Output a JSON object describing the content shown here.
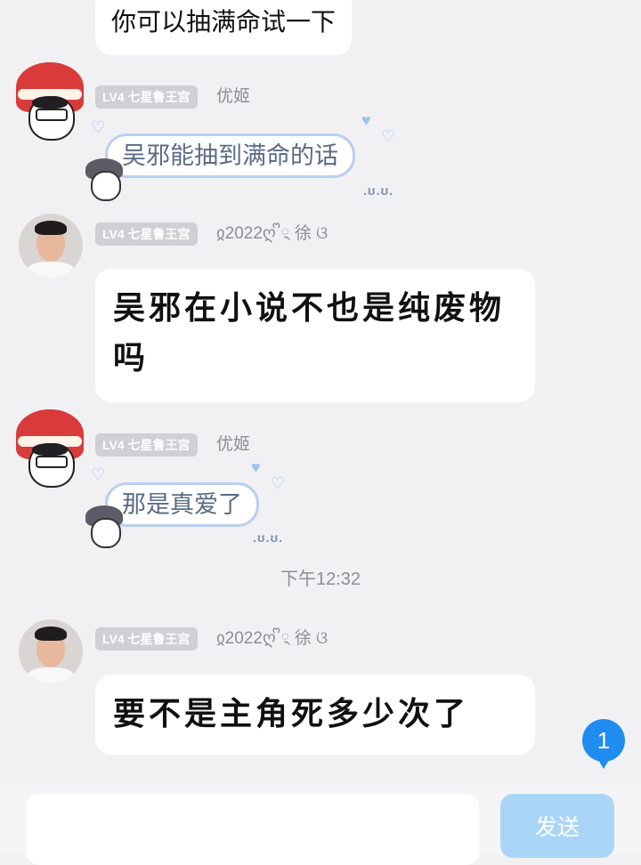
{
  "messages": [
    {
      "text": "你可以抽满命试一下"
    },
    {
      "level": "LV4 七星鲁王宫",
      "sender": "优姬",
      "text": "吴邪能抽到满命的话"
    },
    {
      "level": "LV4 七星鲁王宫",
      "sender": "ჲ2022ღ ᩚ྄  徐 ଓ",
      "text": "吴邪在小说不也是纯废物吗"
    },
    {
      "level": "LV4 七星鲁王宫",
      "sender": "优姬",
      "text": "那是真爱了"
    },
    {
      "level": "LV4 七星鲁王宫",
      "sender": "ჲ2022ღ ᩚ྄  徐 ଓ",
      "text": "要不是主角死多少次了"
    }
  ],
  "timestamp": "下午12:32",
  "unread_count": "1",
  "input": {
    "placeholder": "",
    "send_label": "发送"
  },
  "colors": {
    "background": "#f1f1f4",
    "bubble": "#ffffff",
    "level_badge": "#cfcfd4",
    "send_button": "#a9d6f7",
    "unread_badge": "#1f8cf0",
    "deco_border": "#b8cff0"
  },
  "icons": {
    "avatar_user_a": "anime-avatar-icon",
    "avatar_user_b": "photo-avatar",
    "deco_heart": "heart-icon"
  }
}
